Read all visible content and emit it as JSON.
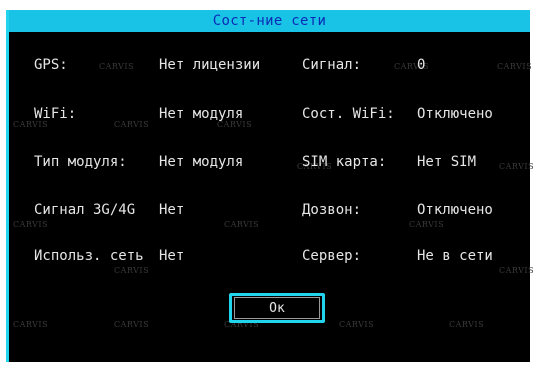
{
  "dialog": {
    "title": "Сост-ние сети"
  },
  "rows": [
    {
      "l1": "GPS:",
      "v1": "Нет лицензии",
      "l2": "Сигнал:",
      "v2": "0"
    },
    {
      "l1": "WiFi:",
      "v1": "Нет модуля",
      "l2": "Сост. WiFi:",
      "v2": "Отключено"
    },
    {
      "l1": "Тип модуля:",
      "v1": "Нет модуля",
      "l2": "SIM карта:",
      "v2": "Нет SIM"
    },
    {
      "l1": "Сигнал 3G/4G",
      "v1": "Нет",
      "l2": "Дозвон:",
      "v2": "Отключено"
    },
    {
      "l1": "Использ. сеть",
      "v1": "Нет",
      "l2": "Сервер:",
      "v2": "Не в сети"
    }
  ],
  "ok_button": {
    "label": "Ок"
  },
  "watermark": "CARVIS",
  "colors": {
    "accent": "#22d3ee",
    "title_bg": "#19c3e6",
    "title_text": "#0b2bb5",
    "background": "#000000",
    "text": "#e6e6e6"
  }
}
